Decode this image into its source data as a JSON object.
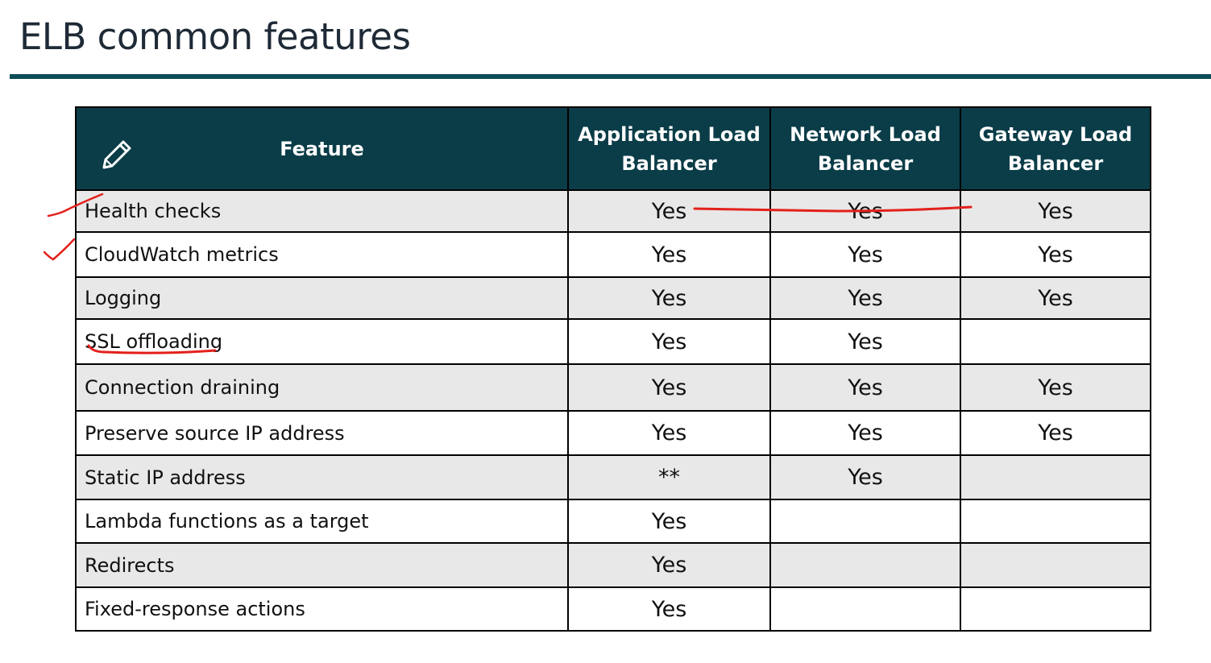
{
  "slide": {
    "title": "ELB common features"
  },
  "table": {
    "headers": [
      "Feature",
      "Application Load Balancer",
      "Network Load Balancer",
      "Gateway Load Balancer"
    ],
    "rows": [
      [
        "Health checks",
        "Yes",
        "Yes",
        "Yes"
      ],
      [
        "CloudWatch metrics",
        "Yes",
        "Yes",
        "Yes"
      ],
      [
        "Logging",
        "Yes",
        "Yes",
        "Yes"
      ],
      [
        "SSL offloading",
        "Yes",
        "Yes",
        ""
      ],
      [
        "Connection draining",
        "Yes",
        "Yes",
        "Yes"
      ],
      [
        "Preserve source IP address",
        "Yes",
        "Yes",
        "Yes"
      ],
      [
        "Static IP address",
        "**",
        "Yes",
        ""
      ],
      [
        "Lambda functions as a target",
        "Yes",
        "",
        ""
      ],
      [
        "Redirects",
        "Yes",
        "",
        ""
      ],
      [
        "Fixed-response actions",
        "Yes",
        "",
        ""
      ]
    ]
  },
  "colors": {
    "header_bg": "#0a3d48",
    "rule": "#0d4d57",
    "row_alt": "#e8e8e8",
    "annotation": "#e3201b"
  },
  "icons": {
    "header_icon": "pencil-icon"
  }
}
